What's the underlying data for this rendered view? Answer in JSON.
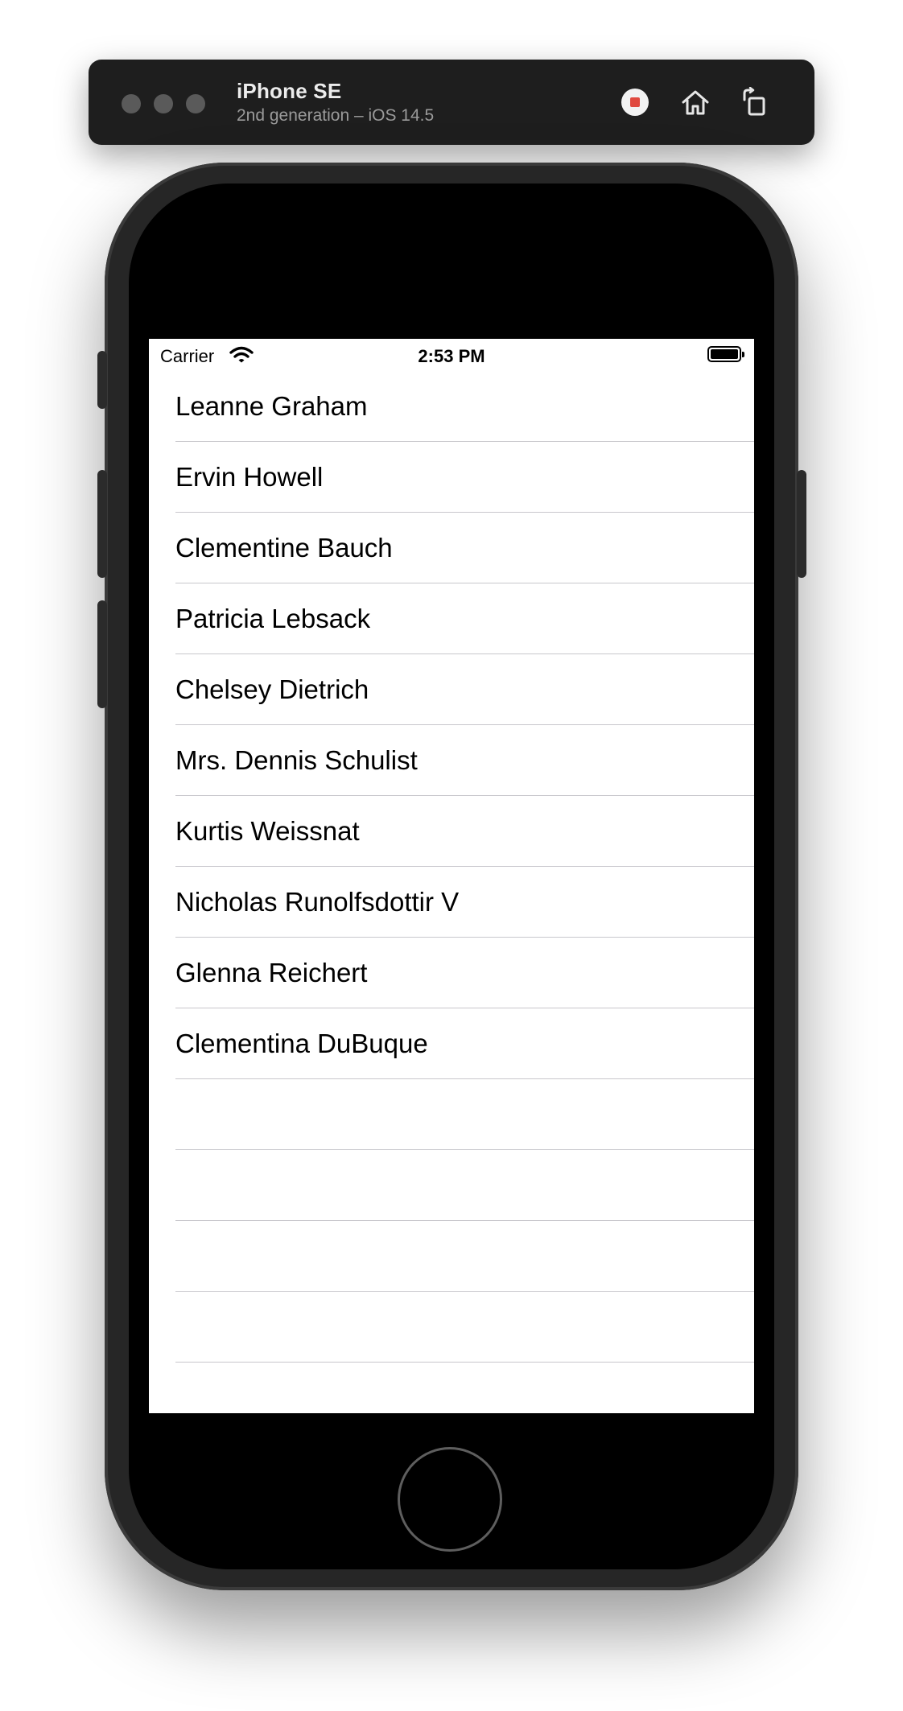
{
  "simulator": {
    "device_name": "iPhone SE",
    "device_detail": "2nd generation – iOS 14.5",
    "record_icon": "record-stop-icon",
    "home_icon": "home-icon",
    "rotate_icon": "rotate-icon"
  },
  "status_bar": {
    "carrier": "Carrier",
    "time": "2:53 PM",
    "wifi_icon": "wifi-icon",
    "battery_icon": "battery-icon"
  },
  "list": {
    "rows": [
      {
        "label": "Leanne Graham"
      },
      {
        "label": "Ervin Howell"
      },
      {
        "label": "Clementine Bauch"
      },
      {
        "label": "Patricia Lebsack"
      },
      {
        "label": "Chelsey Dietrich"
      },
      {
        "label": "Mrs. Dennis Schulist"
      },
      {
        "label": "Kurtis Weissnat"
      },
      {
        "label": "Nicholas Runolfsdottir V"
      },
      {
        "label": "Glenna Reichert"
      },
      {
        "label": "Clementina DuBuque"
      },
      {
        "label": ""
      },
      {
        "label": ""
      },
      {
        "label": ""
      },
      {
        "label": ""
      }
    ]
  },
  "colors": {
    "record_red": "#e0493f",
    "separator": "#c8c7cc",
    "toolbar_bg": "#1e1e1e"
  }
}
